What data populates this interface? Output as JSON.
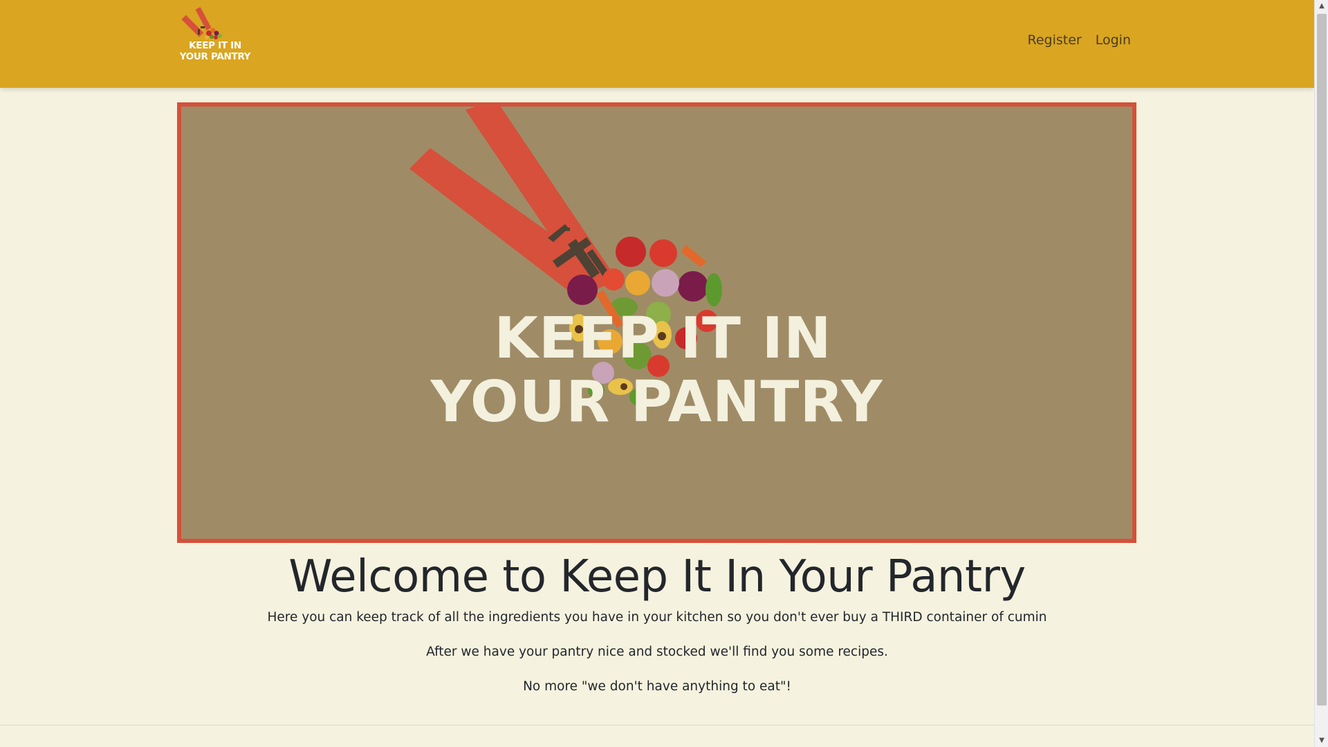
{
  "brand": {
    "line1": "KEEP IT IN",
    "line2": "YOUR PANTRY",
    "icon": "pantry-logo-icon"
  },
  "nav": {
    "register": "Register",
    "login": "Login"
  },
  "hero": {
    "line1": "KEEP IT IN",
    "line2": "YOUR PANTRY",
    "icon": "apron-vegetables-heart-icon",
    "colors": {
      "background": "#9f8c66",
      "border": "#d6503b",
      "apron": "#d6503b",
      "text": "#f3f0de"
    }
  },
  "welcome": {
    "title": "Welcome to Keep It In Your Pantry",
    "p1": "Here you can keep track of all the ingredients you have in your kitchen so you don't ever buy a THIRD container of cumin",
    "p2": "After we have your pantry nice and stocked we'll find you some recipes.",
    "p3": "No more \"we don't have anything to eat\"!"
  },
  "colors": {
    "navbar": "#daa520",
    "page": "#f5f3df",
    "accent": "#d6503b"
  }
}
